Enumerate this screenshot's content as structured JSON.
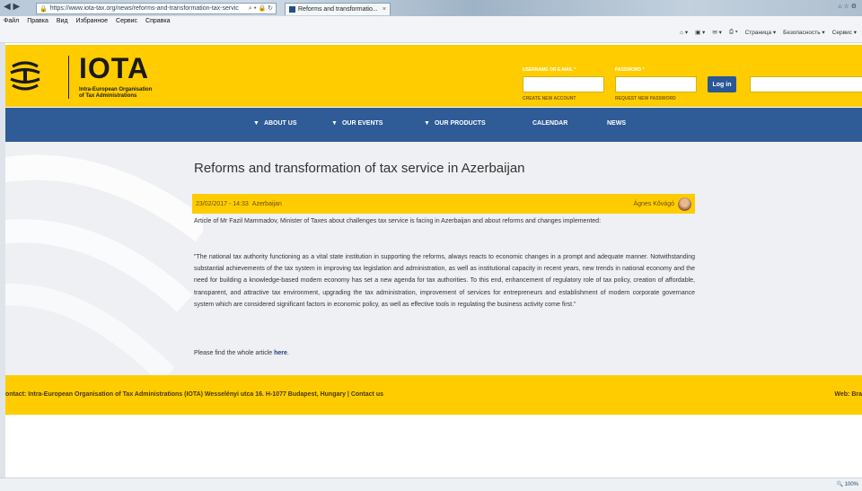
{
  "browser": {
    "url": "https://www.iota-tax.org/news/reforms-and-transformation-tax-servic",
    "tab_title": "Reforms and transformatio...",
    "menu": [
      "Файл",
      "Правка",
      "Вид",
      "Избранное",
      "Сервис",
      "Справка"
    ],
    "tools": [
      "Страница ▾",
      "Безопасность ▾",
      "Сервис ▾"
    ],
    "zoom": "100%"
  },
  "header": {
    "logo_title": "IOTA",
    "logo_sub_line1": "Intra-European Organisation",
    "logo_sub_line2": "of Tax Administrations",
    "username_label": "USERNAME OR E-MAIL *",
    "password_label": "PASSWORD *",
    "create_account": "CREATE NEW ACCOUNT",
    "request_password": "REQUEST NEW PASSWORD",
    "login_button": "Log in",
    "brand_color": "#ffcc00"
  },
  "nav": {
    "items": [
      "ABOUT US",
      "OUR EVENTS",
      "OUR PRODUCTS",
      "CALENDAR",
      "NEWS"
    ],
    "color": "#2f5b96"
  },
  "article": {
    "title": "Reforms and transformation of tax service in Azerbaijan",
    "date": "23/02/2017 - 14:33",
    "tag": "Azerbaijan",
    "author": "Ágnes Kővágó",
    "intro": "Article of Mr Fazil Mammadov, Minister of Taxes about challenges tax service is facing in Azerbaijan and about reforms and changes implemented:",
    "quote": "\"The national tax authority functioning as a vital state institution in supporting the reforms, always reacts to economic changes in a prompt and adequate manner. Notwithstanding substantial achievements of the tax system in improving tax legislation and administration, as well as institutional capacity in recent years, new trends in national economy and the need for building a knowledge-based modern economy has set a new agenda for tax authorities. To this end, enhancement of regulatory role of tax policy, creation of affordable, transparent, and attractive tax environment, upgrading the tax administration, improvement of services for entrepreneurs and establishment of modern corporate governance system which are considered significant factors in economic policy, as well as effective tools in regulating the business activity come first.\"",
    "find_prefix": "Please find the whole article ",
    "find_link": "here",
    "find_suffix": "."
  },
  "footer": {
    "contact": "ontact: Intra-European Organisation of Tax Administrations (IOTA) Wesselényi utca 16. H-1077 Budapest, Hungary | Contact us",
    "web": "Web: Bra"
  }
}
